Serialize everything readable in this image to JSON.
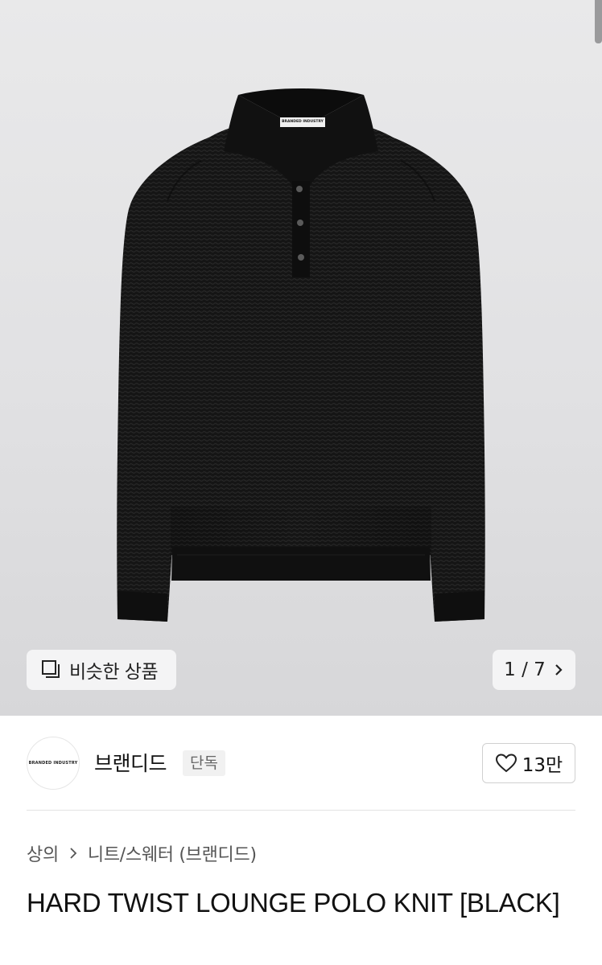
{
  "gallery": {
    "similar_label": "비슷한 상품",
    "similar_icon": "similar-products-icon",
    "current_index": "1",
    "total_count": "7",
    "pager_text": "1 / 7"
  },
  "garment": {
    "label_text": "BRANDED INDUSTRY"
  },
  "brand": {
    "name": "브랜디드",
    "badge": "단독",
    "logo_text": "BRANDED INDUSTRY",
    "like_count": "13만"
  },
  "breadcrumb": {
    "category": "상의",
    "subcategory": "니트/스웨터 (브랜디드)"
  },
  "product": {
    "title": "HARD TWIST LOUNGE POLO KNIT [BLACK]"
  },
  "colors": {
    "hero_bg": "#e3e3e5",
    "garment": "#141414",
    "accent_text": "#111111"
  }
}
